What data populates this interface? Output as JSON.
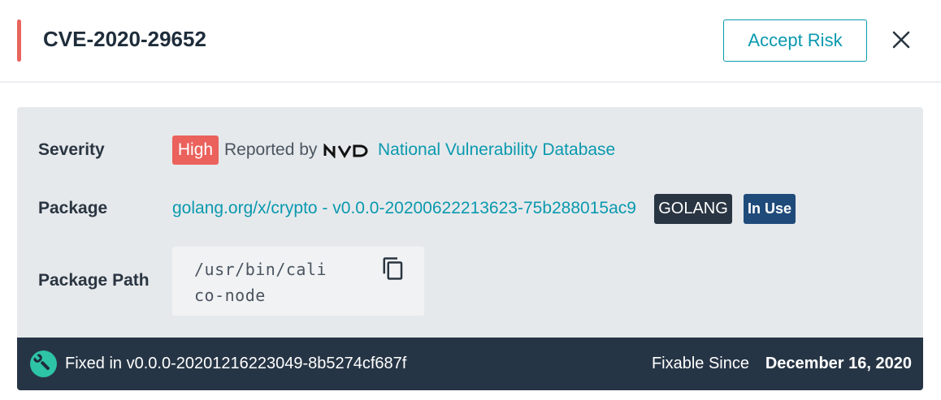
{
  "header": {
    "title": "CVE-2020-29652",
    "accept_risk_label": "Accept Risk",
    "severity_color": "#e8645d"
  },
  "details": {
    "severity": {
      "label": "Severity",
      "value": "High",
      "reported_by_text": "Reported by",
      "source_logo": "NVD",
      "source_link": "National Vulnerability Database"
    },
    "package": {
      "label": "Package",
      "link": "golang.org/x/crypto - v0.0.0-20200622213623-75b288015ac9",
      "language_badge": "GOLANG",
      "status_badge": "In Use"
    },
    "package_path": {
      "label": "Package Path",
      "value": "/usr/bin/calico-node"
    }
  },
  "fix": {
    "fixed_in_text": "Fixed in v0.0.0-20201216223049-8b5274cf687f",
    "fixable_since_label": "Fixable Since",
    "fixable_since_date": "December 16, 2020"
  },
  "icons": {
    "close": "close-icon",
    "copy": "copy-icon",
    "wrench": "wrench-icon"
  },
  "colors": {
    "accent": "#0a99ae",
    "high": "#eb615c",
    "footer": "#263545",
    "in_use": "#1f4b7b"
  }
}
